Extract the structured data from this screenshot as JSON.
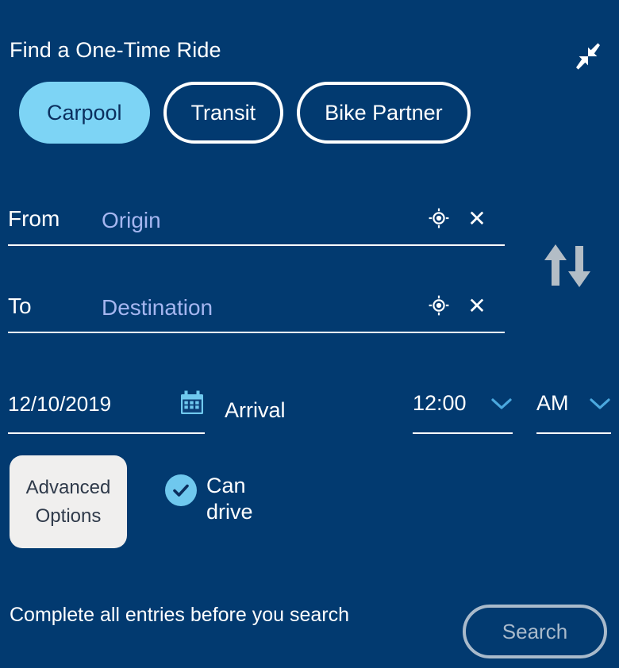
{
  "header": {
    "title": "Find a One-Time Ride",
    "collapse_icon": "collapse-arrows-icon"
  },
  "modes": {
    "selected": "Carpool",
    "options": [
      {
        "label": "Carpool",
        "selected": true
      },
      {
        "label": "Transit",
        "selected": false
      },
      {
        "label": "Bike Partner",
        "selected": false
      }
    ]
  },
  "location": {
    "from": {
      "label": "From",
      "value": "",
      "placeholder": "Origin",
      "locate_icon": "crosshair-locate-icon",
      "clear_icon": "✕"
    },
    "to": {
      "label": "To",
      "value": "",
      "placeholder": "Destination",
      "locate_icon": "crosshair-locate-icon",
      "clear_icon": "✕"
    },
    "swap_icon": "swap-up-down-arrows-icon"
  },
  "schedule": {
    "date": "12/10/2019",
    "calendar_icon": "calendar-icon",
    "time_mode": "Arrival",
    "time_value": "12:00",
    "meridiem": "AM",
    "chevron_icon": "chevron-down-icon"
  },
  "options_row": {
    "advanced_label": "Advanced Options",
    "can_drive_label": "Can drive",
    "can_drive_checked": true,
    "check_icon": "check-icon"
  },
  "footer": {
    "status_message": "Complete all entries before you search",
    "search_label": "Search",
    "search_enabled": false
  },
  "colors": {
    "background": "#023A70",
    "accent_light_blue": "#7DD4F5",
    "placeholder_blue": "#A5B6F0",
    "advanced_bg": "#F0EFEE",
    "disabled_gray": "#A9BACB",
    "swap_arrow_gray": "#B3BDC6",
    "calendar_blue": "#6FC8EE"
  }
}
